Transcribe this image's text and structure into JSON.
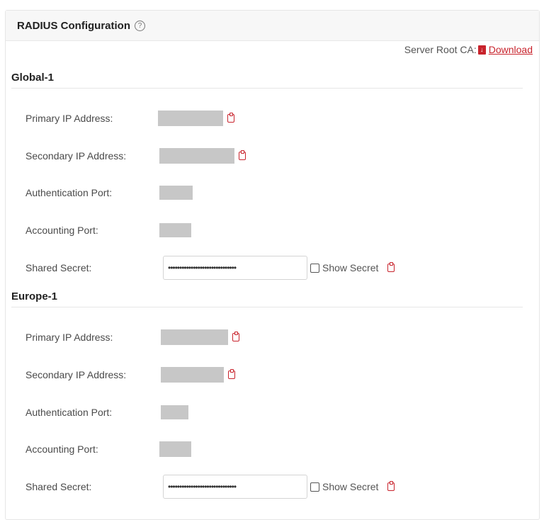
{
  "panel": {
    "title": "RADIUS Configuration",
    "help_icon": "help-circle-icon"
  },
  "root_ca": {
    "label": "Server Root CA:",
    "icon": "pdf-file-icon",
    "link_label": "Download"
  },
  "colors": {
    "accent": "#c8232c",
    "mask": "#c7c7c7"
  },
  "sections": [
    {
      "title": "Global-1",
      "primary_ip_label": "Primary IP Address:",
      "secondary_ip_label": "Secondary IP Address:",
      "auth_port_label": "Authentication Port:",
      "acct_port_label": "Accounting Port:",
      "shared_secret_label": "Shared Secret:",
      "shared_secret_value": "••••••••••••••••••••••••••••••",
      "show_secret_label": "Show Secret",
      "show_secret_checked": false
    },
    {
      "title": "Europe-1",
      "primary_ip_label": "Primary IP Address:",
      "secondary_ip_label": "Secondary IP Address:",
      "auth_port_label": "Authentication Port:",
      "acct_port_label": "Accounting Port:",
      "shared_secret_label": "Shared Secret:",
      "shared_secret_value": "••••••••••••••••••••••••••••••",
      "show_secret_label": "Show Secret",
      "show_secret_checked": false
    }
  ]
}
